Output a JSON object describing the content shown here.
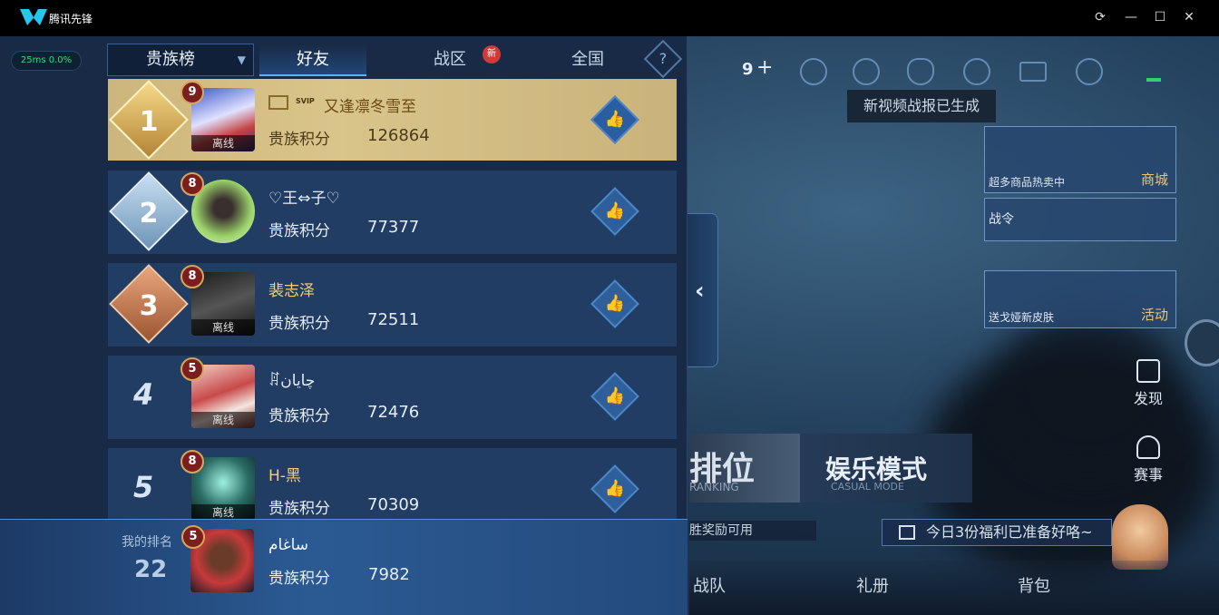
{
  "window": {
    "app_name": "腾讯先锋",
    "controls": [
      "⟳",
      "—",
      "☐",
      "✕"
    ]
  },
  "status": {
    "ping": "25ms",
    "loss": "0.0%"
  },
  "leaderboard": {
    "dropdown_value": "贵族榜",
    "tabs": [
      {
        "label": "好友",
        "active": true
      },
      {
        "label": "战区",
        "active": false,
        "badge": "新"
      },
      {
        "label": "全国",
        "active": false
      }
    ],
    "help_label": "?",
    "score_label": "贵族积分",
    "offline_label": "离线",
    "rows": [
      {
        "rank": "1",
        "level": "9",
        "name": "又逢凛冬雪至",
        "score": "126864",
        "offline": true
      },
      {
        "rank": "2",
        "level": "8",
        "name": "♡王⇔子♡",
        "score": "77377",
        "offline": false
      },
      {
        "rank": "3",
        "level": "8",
        "name": "裴志泽",
        "score": "72511",
        "offline": true
      },
      {
        "rank": "4",
        "level": "5",
        "name": "ꁲچایان",
        "score": "72476",
        "offline": true
      },
      {
        "rank": "5",
        "level": "8",
        "name": "H-黑",
        "score": "70309",
        "offline": true
      }
    ],
    "vip_badge": "SVIP",
    "my_rank": {
      "title": "我的排名",
      "rank": "22",
      "level": "5",
      "name": "ساغام",
      "score": "7982"
    }
  },
  "background_ui": {
    "top_counter": "9",
    "video_toast": "新视频战报已生成",
    "side_cards": [
      {
        "sub": "超多商品热卖中",
        "tag": "商城"
      },
      {
        "sub": "战令",
        "tag": ""
      },
      {
        "sub": "送戈娅新皮肤",
        "tag": "活动"
      }
    ],
    "side_nav": [
      "发现",
      "赛事"
    ],
    "rank_mode": {
      "label": "排位",
      "sub": "RANKING"
    },
    "casual_mode": {
      "label": "娱乐模式",
      "sub": "CASUAL MODE"
    },
    "tip_text": "胜奖励可用",
    "gift_text": "今日3份福利已准备好咯~",
    "bottom_nav": [
      "战队",
      "礼册",
      "背包"
    ]
  }
}
